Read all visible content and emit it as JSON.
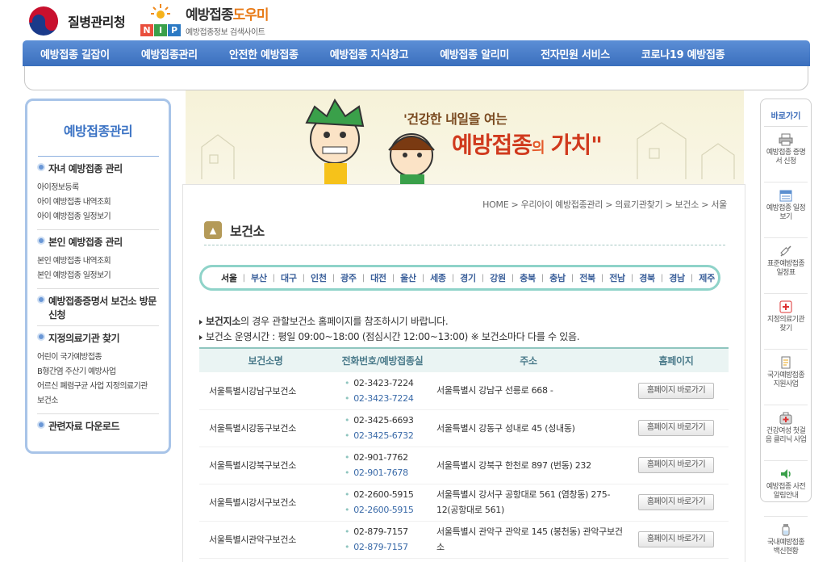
{
  "header": {
    "org_name": "질병관리청",
    "nip_letters": [
      "N",
      "I",
      "P"
    ],
    "site_title_main": "예방접종",
    "site_title_accent": "도우미",
    "site_subtitle": "예방접종정보 검색사이트"
  },
  "nav": [
    "예방접종 길잡이",
    "예방접종관리",
    "안전한 예방접종",
    "예방접종 지식창고",
    "예방접종 알리미",
    "전자민원 서비스",
    "코로나19 예방접종"
  ],
  "lnb": {
    "title": "예방접종관리",
    "sections": [
      {
        "head": "자녀 예방접종 관리",
        "items": [
          "아이정보등록",
          "아이 예방접종 내역조회",
          "아이 예방접종 일정보기"
        ]
      },
      {
        "head": "본인 예방접종 관리",
        "items": [
          "본인 예방접종 내역조회",
          "본인 예방접종 일정보기"
        ]
      },
      {
        "head": "예방접종증명서 보건소 방문신청",
        "items": []
      },
      {
        "head": "지정의료기관 찾기",
        "items": [
          "어린이 국가예방접종",
          "B형간염 주산기 예방사업",
          "어르신 폐렴구균 사업 지정의료기관",
          "보건소"
        ]
      },
      {
        "head": "관련자료 다운로드",
        "items": []
      }
    ]
  },
  "banner": {
    "slogan": "'건강한 내일을 여는",
    "main_a": "예방접종",
    "main_b": "의",
    "main_c": "가치\""
  },
  "breadcrumb": "HOME > 우리아이 예방접종관리 > 의료기관찾기 > 보건소 > 서울",
  "page_title": "보건소",
  "regions": [
    "서울",
    "부산",
    "대구",
    "인천",
    "광주",
    "대전",
    "울산",
    "세종",
    "경기",
    "강원",
    "충북",
    "충남",
    "전북",
    "전남",
    "경북",
    "경남",
    "제주"
  ],
  "notice": {
    "line1_bold": "보건지소",
    "line1_rest": "의 경우 관할보건소 홈페이지를 참조하시기 바랍니다.",
    "line2": "보건소 운영시간 : 평일 09:00~18:00 (점심시간 12:00~13:00) ※ 보건소마다 다를 수 있음."
  },
  "table": {
    "headers": [
      "보건소명",
      "전화번호/예방접종실",
      "주소",
      "홈페이지"
    ],
    "button_label": "홈페이지 바로가기",
    "rows": [
      {
        "name": "서울특별시강남구보건소",
        "tel1": "02-3423-7224",
        "tel2": "02-3423-7224",
        "addr": "서울특별시 강남구 선릉로 668 -"
      },
      {
        "name": "서울특별시강동구보건소",
        "tel1": "02-3425-6693",
        "tel2": "02-3425-6732",
        "addr": "서울특별시 강동구 성내로 45 (성내동)"
      },
      {
        "name": "서울특별시강북구보건소",
        "tel1": "02-901-7762",
        "tel2": "02-901-7678",
        "addr": "서울특별시 강북구 한천로 897 (번동) 232"
      },
      {
        "name": "서울특별시강서구보건소",
        "tel1": "02-2600-5915",
        "tel2": "02-2600-5915",
        "addr": "서울특별시 강서구 공항대로 561 (염창동) 275-12(공항대로 561)"
      },
      {
        "name": "서울특별시관악구보건소",
        "tel1": "02-879-7157",
        "tel2": "02-879-7157",
        "addr": "서울특별시 관악구 관악로 145 (봉천동) 관악구보건소"
      }
    ]
  },
  "quick": {
    "title": "바로가기",
    "items": [
      {
        "label": "예방접종 증명서 신청",
        "icon": "printer-icon"
      },
      {
        "label": "예방접종 일정보기",
        "icon": "calendar-icon"
      },
      {
        "label": "표준예방접종 일정표",
        "icon": "syringe-icon"
      },
      {
        "label": "지정의료기관 찾기",
        "icon": "hospital-icon"
      },
      {
        "label": "국가예방접종 지원사업",
        "icon": "document-icon"
      },
      {
        "label": "건강여성 첫걸음 클리닉 사업",
        "icon": "medkit-icon"
      },
      {
        "label": "예방접종 사전알림안내",
        "icon": "speaker-icon"
      },
      {
        "label": "국내예방접종 백신현황",
        "icon": "vaccine-icon"
      }
    ]
  },
  "colors": {
    "nav": "#3a6fbd",
    "sidebar_border": "#a8c4e8",
    "region_border": "#8fd3c9",
    "accent_orange": "#e87a16"
  }
}
